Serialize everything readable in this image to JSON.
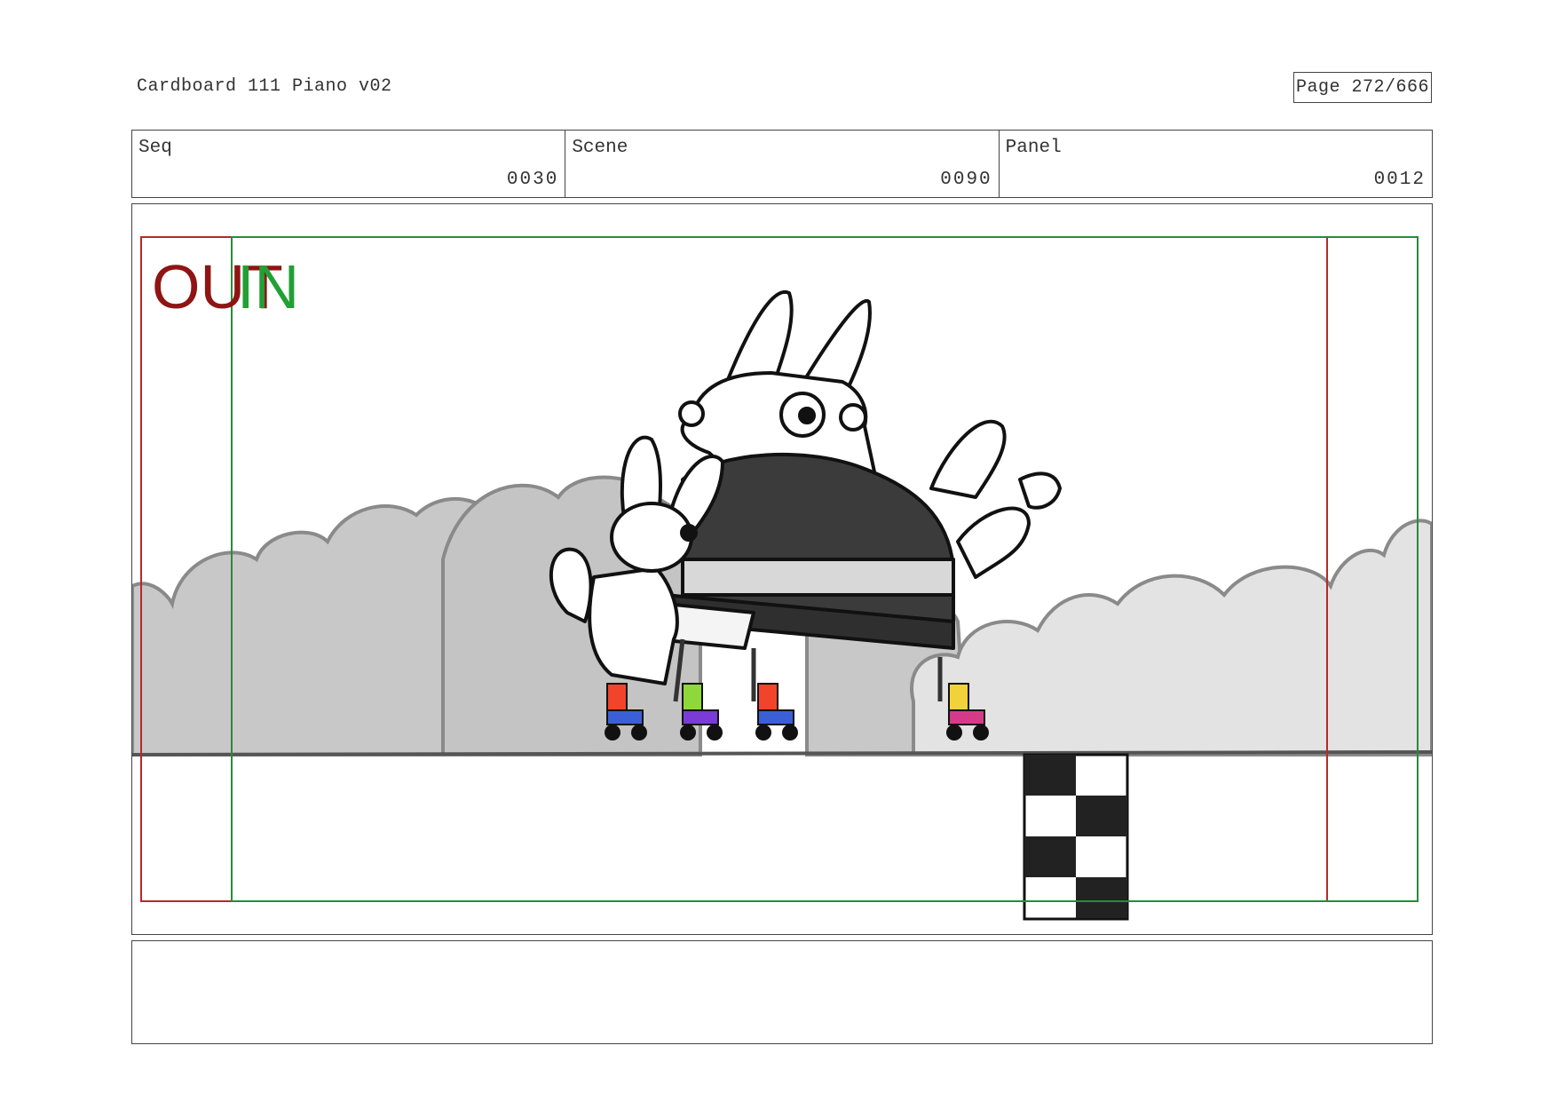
{
  "header": {
    "title": "Cardboard 111 Piano v02",
    "page": "Page 272/666"
  },
  "info": {
    "seq_label": "Seq",
    "seq_value": "0030",
    "scene_label": "Scene",
    "scene_value": "0090",
    "panel_label": "Panel",
    "panel_value": "0012"
  },
  "frame": {
    "out_tag": "OUT",
    "in_tag": "IN",
    "out_color": "#b52a2a",
    "in_color": "#2a8a3a"
  },
  "notes": {
    "text": ""
  }
}
